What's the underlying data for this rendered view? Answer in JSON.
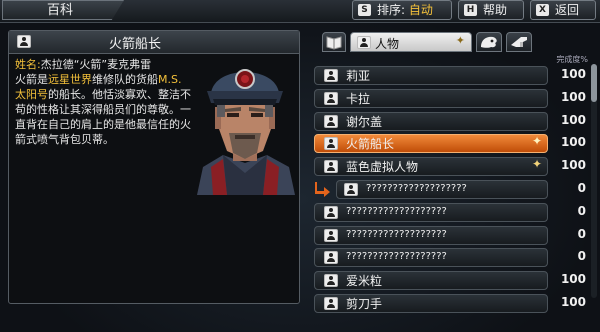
{
  "header": {
    "title": "百科",
    "sort_key": "S",
    "sort_label": "排序:",
    "sort_value": "自动",
    "help_key": "H",
    "help_label": "帮助",
    "back_key": "X",
    "back_label": "返回"
  },
  "detail": {
    "title": "火箭船长",
    "name_label": "姓名:",
    "name_value": "杰拉德“火箭”麦克弗雷",
    "bio_line1_a": "火箭是",
    "bio_line1_hl": "远星世界",
    "bio_line1_b": "维修队的货船",
    "bio_line1_hl2": "M.S.",
    "bio_line2_hl": "太阳号",
    "bio_line2_b": "的船长。他恬淡寡欢、整洁不",
    "bio_line3": "苟的性格让其深得船员们的尊敬。一",
    "bio_line4": "直背在自己的肩上的是他最信任的火",
    "bio_line5": "箭式喷气背包贝蒂。"
  },
  "tabs": {
    "active_label": "人物"
  },
  "list_header": "完成度%",
  "entries": [
    {
      "name": "莉亚",
      "percent": "100"
    },
    {
      "name": "卡拉",
      "percent": "100"
    },
    {
      "name": "谢尔盖",
      "percent": "100"
    },
    {
      "name": "火箭船长",
      "percent": "100"
    },
    {
      "name": "蓝色虚拟人物",
      "percent": "100"
    },
    {
      "name": "???????????????????",
      "percent": "0"
    },
    {
      "name": "???????????????????",
      "percent": "0"
    },
    {
      "name": "???????????????????",
      "percent": "0"
    },
    {
      "name": "???????????????????",
      "percent": "0"
    },
    {
      "name": "爱米粒",
      "percent": "100"
    },
    {
      "name": "剪刀手",
      "percent": "100"
    }
  ],
  "colors": {
    "highlight": "#f3c03a",
    "selected_row": "#e0701f"
  }
}
